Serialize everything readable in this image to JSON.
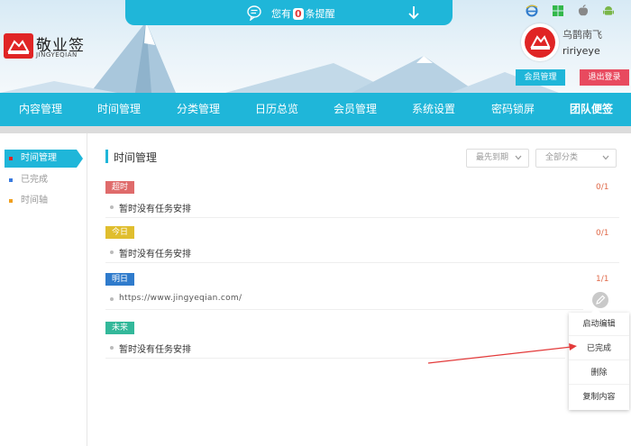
{
  "notice": {
    "prefix": "您有",
    "count": "0",
    "suffix": "条提醒"
  },
  "brand": {
    "name": "敬业签",
    "name_en": "JINGYEQIAN"
  },
  "platforms": [
    "ie-icon",
    "windows-icon",
    "apple-icon",
    "android-icon"
  ],
  "user": {
    "nickname": "乌鹊南飞",
    "username": "ririyeye",
    "member_btn": "会员管理",
    "logout_btn": "退出登录"
  },
  "nav": [
    "内容管理",
    "时间管理",
    "分类管理",
    "日历总览",
    "会员管理",
    "系统设置",
    "密码锁屏",
    "团队便签"
  ],
  "sidebar": [
    {
      "label": "时间管理",
      "dot_color": "#e02525"
    },
    {
      "label": "已完成",
      "dot_color": "#3a7be0"
    },
    {
      "label": "时间轴",
      "dot_color": "#f0a020"
    }
  ],
  "main": {
    "title": "时间管理",
    "sort_select": "最先到期",
    "category_select": "全部分类"
  },
  "groups": [
    {
      "tag": "超时",
      "ratio": "0/1",
      "item": "暂时没有任务安排"
    },
    {
      "tag": "今日",
      "ratio": "0/1",
      "item": "暂时没有任务安排"
    },
    {
      "tag": "明日",
      "ratio": "1/1",
      "item": "https://www.jingyeqian.com/"
    },
    {
      "tag": "未来",
      "ratio": "",
      "item": "暂时没有任务安排"
    }
  ],
  "context_menu": [
    "启动编辑",
    "已完成",
    "删除",
    "复制内容"
  ],
  "colors": {
    "accent": "#1fb6d9",
    "logout": "#e84a5f",
    "brand_red": "#e02525"
  }
}
